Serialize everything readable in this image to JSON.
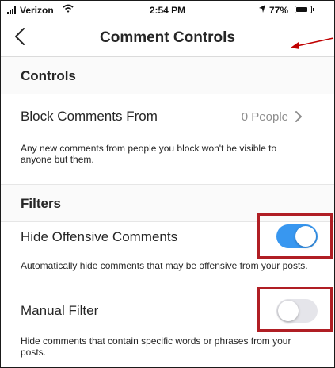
{
  "status_bar": {
    "carrier": "Verizon",
    "time": "2:54 PM",
    "battery": "77%",
    "battery_level": 0.77,
    "icons": [
      "signal-bars-icon",
      "wifi-icon",
      "location-arrow-icon",
      "battery-icon"
    ]
  },
  "nav": {
    "title": "Comment Controls",
    "back_icon": "chevron-left-icon"
  },
  "annotations": {
    "arrow_color": "#c00000",
    "box_color": "#b01e24"
  },
  "controls": {
    "section_title": "Controls",
    "block_comments": {
      "label": "Block Comments From",
      "value": "0 People",
      "chevron_icon": "chevron-right-icon"
    },
    "block_description": "Any new comments from people you block won't be visible to anyone but them."
  },
  "filters": {
    "section_title": "Filters",
    "hide_offensive": {
      "label": "Hide Offensive Comments",
      "enabled": true,
      "description": "Automatically hide comments that may be offensive from your posts."
    },
    "manual_filter": {
      "label": "Manual Filter",
      "enabled": false,
      "description": "Hide comments that contain specific words or phrases from your posts."
    }
  },
  "colors": {
    "toggle_on": "#3897f0",
    "toggle_off": "#e5e5ea",
    "secondary_text": "#8e8e8e"
  }
}
